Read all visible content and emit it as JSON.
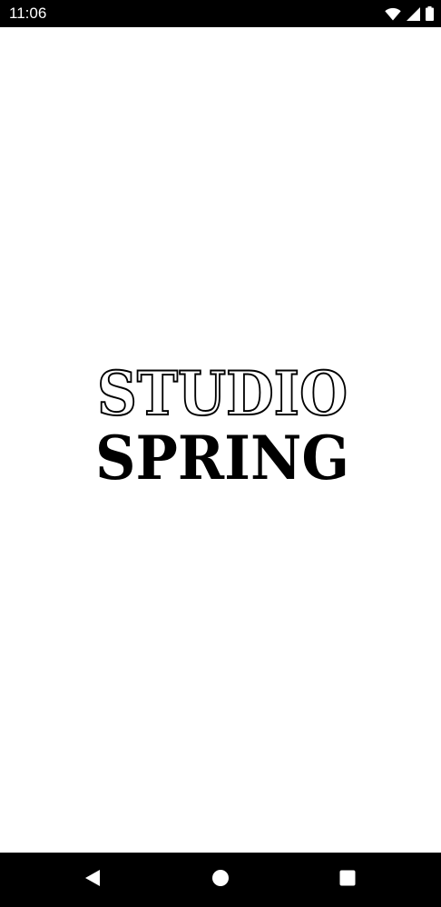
{
  "status_bar": {
    "time": "11:06",
    "icons": [
      "wifi-icon",
      "signal-icon",
      "battery-icon"
    ]
  },
  "splash": {
    "logo": {
      "line1": "STUDIO",
      "line2": "SPRING"
    }
  },
  "nav_bar": {
    "buttons": [
      "back-icon",
      "home-icon",
      "recents-icon"
    ]
  },
  "colors": {
    "bars": "#000000",
    "background": "#ffffff",
    "logo": "#000000"
  }
}
